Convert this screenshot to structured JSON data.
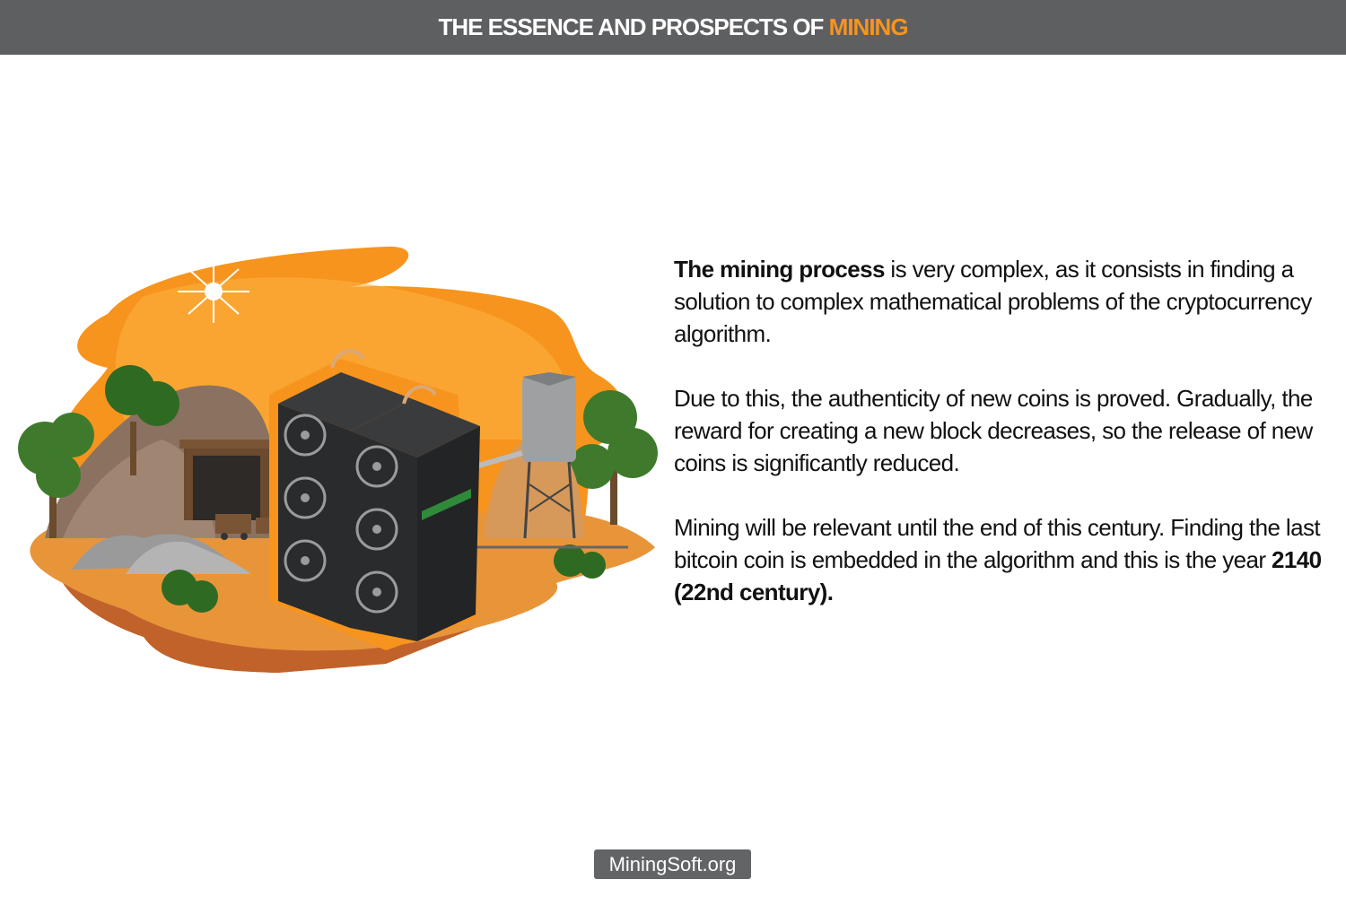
{
  "header": {
    "title_prefix": "THE ESSENCE AND PROSPECTS OF ",
    "title_accent": "MINING",
    "background_color": "#5e5f61",
    "accent_color": "#f7941d"
  },
  "content": {
    "p1_bold": "The mining process",
    "p1_rest": " is very complex, as it consists in finding a solution to complex mathematical problems of the cryptocurrency algorithm.",
    "p2": "Due to this, the authenticity of new coins is proved. Gradually, the reward for creating a new block decreases, so the release of new coins is significantly reduced.",
    "p3_start": "Mining will be relevant until the end of this century. Finding the last bitcoin coin is embedded in the algorithm and this is the year ",
    "p3_bold": "2140 (22nd century)."
  },
  "footer": {
    "badge": "MiningSoft.org"
  },
  "illustration": {
    "icon": "mining-farm-illustration"
  }
}
